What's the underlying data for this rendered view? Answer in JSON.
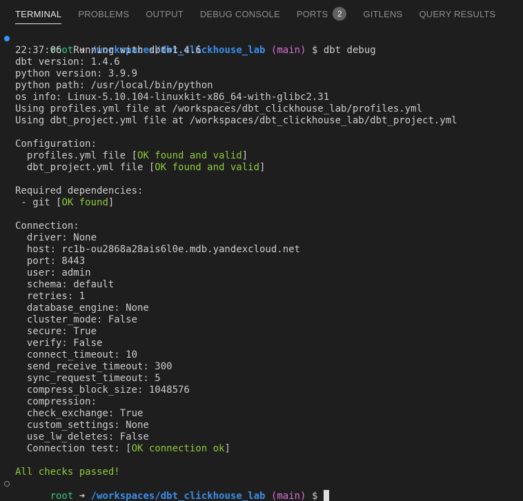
{
  "tabs": [
    {
      "label": "TERMINAL",
      "active": true
    },
    {
      "label": "PROBLEMS"
    },
    {
      "label": "OUTPUT"
    },
    {
      "label": "DEBUG CONSOLE"
    },
    {
      "label": "PORTS",
      "badge": "2"
    },
    {
      "label": "GITLENS"
    },
    {
      "label": "QUERY RESULTS"
    }
  ],
  "prompt": {
    "user": "root",
    "arrow": "➜",
    "path": "/workspaces/dbt_clickhouse_lab",
    "branch_open": "(",
    "branch": "main",
    "branch_close": ")",
    "symbol": "$",
    "command": "dbt debug"
  },
  "output": {
    "l1": "22:37:06  Running with dbt=1.4.6",
    "l2": "dbt version: 1.4.6",
    "l3": "python version: 3.9.9",
    "l4": "python path: /usr/local/bin/python",
    "l5": "os info: Linux-5.10.104-linuxkit-x86_64-with-glibc2.31",
    "l6": "Using profiles.yml file at /workspaces/dbt_clickhouse_lab/profiles.yml",
    "l7": "Using dbt_project.yml file at /workspaces/dbt_clickhouse_lab/dbt_project.yml",
    "config_header": "Configuration:",
    "profiles_pre": "  profiles.yml file [",
    "profiles_ok": "OK found and valid",
    "project_pre": "  dbt_project.yml file [",
    "project_ok": "OK found and valid",
    "close_bracket": "]",
    "deps_header": "Required dependencies:",
    "git_pre": " - git [",
    "git_ok": "OK found",
    "conn_header": "Connection:",
    "conn": [
      "  driver: None",
      "  host: rc1b-ou2868a28ais6l0e.mdb.yandexcloud.net",
      "  port: 8443",
      "  user: admin",
      "  schema: default",
      "  retries: 1",
      "  database_engine: None",
      "  cluster_mode: False",
      "  secure: True",
      "  verify: False",
      "  connect_timeout: 10",
      "  send_receive_timeout: 300",
      "  sync_request_timeout: 5",
      "  compress_block_size: 1048576",
      "  compression: ",
      "  check_exchange: True",
      "  custom_settings: None",
      "  use_lw_deletes: False"
    ],
    "conn_test_pre": "  Connection test: [",
    "conn_test_ok": "OK connection ok",
    "all_passed": "All checks passed!"
  }
}
